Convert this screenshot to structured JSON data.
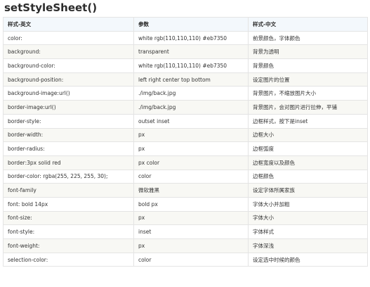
{
  "title": "setStyleSheet()",
  "table": {
    "headers": [
      "样式-英文",
      "参数",
      "样式-中文"
    ],
    "rows": [
      [
        "color:",
        "white rgb(110,110,110) #eb7350",
        "前景颜色，字体颜色"
      ],
      [
        "background:",
        "transparent",
        "背景为透明"
      ],
      [
        "background-color:",
        "white rgb(110,110,110) #eb7350",
        "背景颜色"
      ],
      [
        "background-position:",
        "left right center top bottom",
        "设定图片的位置"
      ],
      [
        "background-image:url()",
        "./img/back.jpg",
        "背景图片，不缩放图片大小"
      ],
      [
        "border-image:url()",
        "./img/back.jpg",
        "背景图片，会对图片进行拉伸，平铺"
      ],
      [
        "border-style:",
        "outset inset",
        "边框样式，按下是inset"
      ],
      [
        "border-width:",
        "px",
        "边框大小"
      ],
      [
        "border-radius:",
        "px",
        "边框弧度"
      ],
      [
        "border:3px solid red",
        "px color",
        "边框宽度以及颜色"
      ],
      [
        "border-color: rgba(255, 225, 255, 30);",
        "color",
        "边框颜色"
      ],
      [
        "font-family",
        "微软雅黑",
        "设定字体所属家族"
      ],
      [
        "font: bold 14px",
        "bold px",
        "字体大小并加粗"
      ],
      [
        "font-size:",
        "px",
        "字体大小"
      ],
      [
        "font-style:",
        "inset",
        "字体样式"
      ],
      [
        "font-weight:",
        "px",
        "字体深浅"
      ],
      [
        "selection-color:",
        "color",
        "设定选中时候的颜色"
      ]
    ]
  }
}
